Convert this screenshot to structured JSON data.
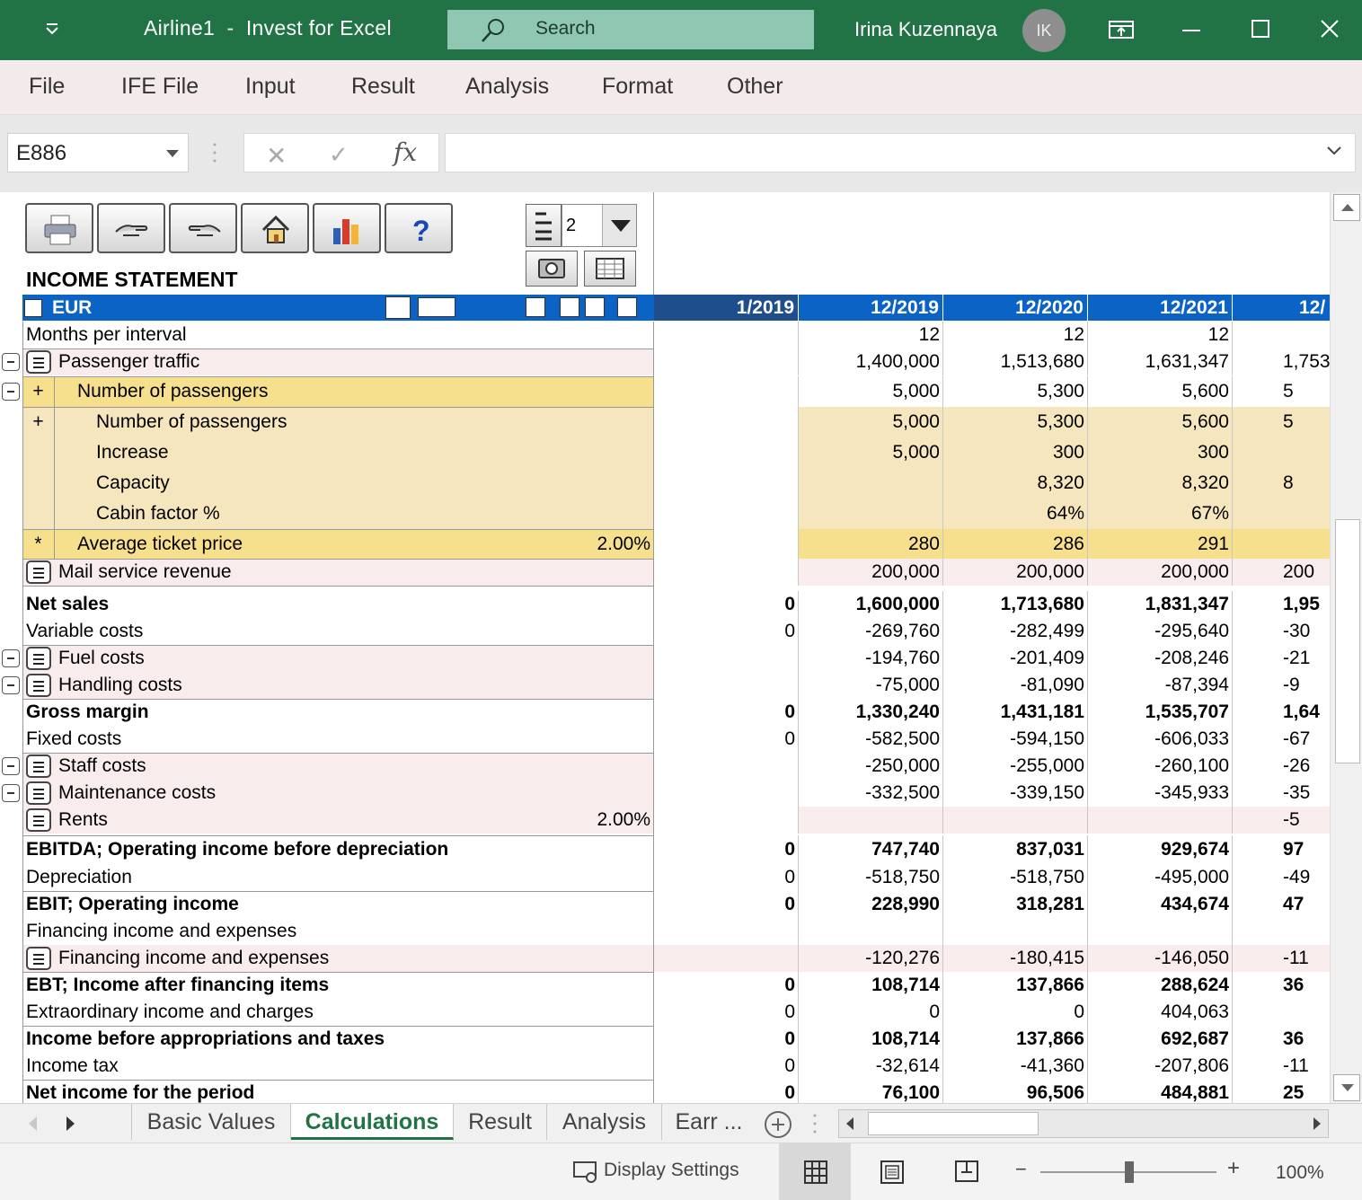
{
  "window": {
    "title": "Airline1  -  Invest for Excel",
    "search_label": "Search",
    "user_name": "Irina Kuzennayа",
    "user_initials": "IK"
  },
  "menu": [
    "File",
    "IFE File",
    "Input",
    "Result",
    "Analysis",
    "Format",
    "Other"
  ],
  "formula_bar": {
    "name_box": "E886",
    "formula": ""
  },
  "sheet": {
    "title": "INCOME STATEMENT",
    "level_value": "2",
    "currency": "EUR",
    "periods": [
      "1/2019",
      "12/2019",
      "12/2020",
      "12/2021",
      "12/"
    ],
    "rows": [
      {
        "label": "Months per interval",
        "rate": "",
        "values": [
          "",
          "12",
          "12",
          "12",
          ""
        ]
      },
      {
        "label": "Passenger traffic",
        "rate": "",
        "values": [
          "",
          "1,400,000",
          "1,513,680",
          "1,631,347",
          "1,753"
        ]
      },
      {
        "label": "Number of passengers",
        "rate": "",
        "mark": "+",
        "values": [
          "",
          "5,000",
          "5,300",
          "5,600",
          "5"
        ]
      },
      {
        "label": "Number of passengers",
        "rate": "",
        "mark": "+",
        "values": [
          "",
          "5,000",
          "5,300",
          "5,600",
          "5"
        ]
      },
      {
        "label": "Increase",
        "rate": "",
        "values": [
          "",
          "5,000",
          "300",
          "300",
          ""
        ]
      },
      {
        "label": "Capacity",
        "rate": "",
        "values": [
          "",
          "",
          "8,320",
          "8,320",
          "8"
        ]
      },
      {
        "label": "Cabin factor %",
        "rate": "",
        "values": [
          "",
          "",
          "64%",
          "67%",
          ""
        ]
      },
      {
        "label": "Average ticket price",
        "rate": "2.00%",
        "mark": "*",
        "values": [
          "",
          "280",
          "286",
          "291",
          ""
        ]
      },
      {
        "label": "Mail service revenue",
        "rate": "",
        "values": [
          "",
          "200,000",
          "200,000",
          "200,000",
          "200"
        ]
      },
      {
        "label": "Net sales",
        "rate": "",
        "values": [
          "0",
          "1,600,000",
          "1,713,680",
          "1,831,347",
          "1,95"
        ]
      },
      {
        "label": "Variable costs",
        "rate": "",
        "values": [
          "0",
          "-269,760",
          "-282,499",
          "-295,640",
          "-30"
        ]
      },
      {
        "label": "Fuel costs",
        "rate": "",
        "values": [
          "",
          "-194,760",
          "-201,409",
          "-208,246",
          "-21"
        ]
      },
      {
        "label": "Handling costs",
        "rate": "",
        "values": [
          "",
          "-75,000",
          "-81,090",
          "-87,394",
          "-9"
        ]
      },
      {
        "label": "Gross margin",
        "rate": "",
        "values": [
          "0",
          "1,330,240",
          "1,431,181",
          "1,535,707",
          "1,64"
        ]
      },
      {
        "label": "Fixed costs",
        "rate": "",
        "values": [
          "0",
          "-582,500",
          "-594,150",
          "-606,033",
          "-67"
        ]
      },
      {
        "label": "Staff costs",
        "rate": "",
        "values": [
          "",
          "-250,000",
          "-255,000",
          "-260,100",
          "-26"
        ]
      },
      {
        "label": "Maintenance costs",
        "rate": "",
        "values": [
          "",
          "-332,500",
          "-339,150",
          "-345,933",
          "-35"
        ]
      },
      {
        "label": "Rents",
        "rate": "2.00%",
        "values": [
          "",
          "",
          "",
          "",
          "-5"
        ]
      },
      {
        "label": "EBITDA; Operating income before depreciation",
        "rate": "",
        "values": [
          "0",
          "747,740",
          "837,031",
          "929,674",
          "97"
        ]
      },
      {
        "label": "Depreciation",
        "rate": "",
        "values": [
          "0",
          "-518,750",
          "-518,750",
          "-495,000",
          "-49"
        ]
      },
      {
        "label": "EBIT; Operating income",
        "rate": "",
        "values": [
          "0",
          "228,990",
          "318,281",
          "434,674",
          "47"
        ]
      },
      {
        "label": "Financing income and expenses",
        "rate": "",
        "values": [
          "",
          "",
          "",
          "",
          ""
        ]
      },
      {
        "label": "Financing income and expenses",
        "rate": "",
        "values": [
          "",
          "-120,276",
          "-180,415",
          "-146,050",
          "-11"
        ]
      },
      {
        "label": "EBT; Income after financing items",
        "rate": "",
        "values": [
          "0",
          "108,714",
          "137,866",
          "288,624",
          "36"
        ]
      },
      {
        "label": "Extraordinary income and charges",
        "rate": "",
        "values": [
          "0",
          "0",
          "0",
          "404,063",
          ""
        ]
      },
      {
        "label": "Income before appropriations and taxes",
        "rate": "",
        "values": [
          "0",
          "108,714",
          "137,866",
          "692,687",
          "36"
        ]
      },
      {
        "label": "Income tax",
        "rate": "",
        "values": [
          "0",
          "-32,614",
          "-41,360",
          "-207,806",
          "-11"
        ]
      },
      {
        "label": "Net income for the period",
        "rate": "",
        "values": [
          "0",
          "76,100",
          "96,506",
          "484,881",
          "25"
        ]
      }
    ]
  },
  "sheet_tabs": [
    "Basic Values",
    "Calculations",
    "Result",
    "Analysis",
    "Earr ..."
  ],
  "active_tab": "Calculations",
  "status": {
    "display_settings": "Display Settings",
    "zoom": "100%"
  },
  "colors": {
    "excel_green": "#217346",
    "header_blue": "#0b63c6",
    "row_pink": "#f8ecec",
    "row_tan": "#f6e6bd",
    "row_yellow": "#f6e08e"
  }
}
